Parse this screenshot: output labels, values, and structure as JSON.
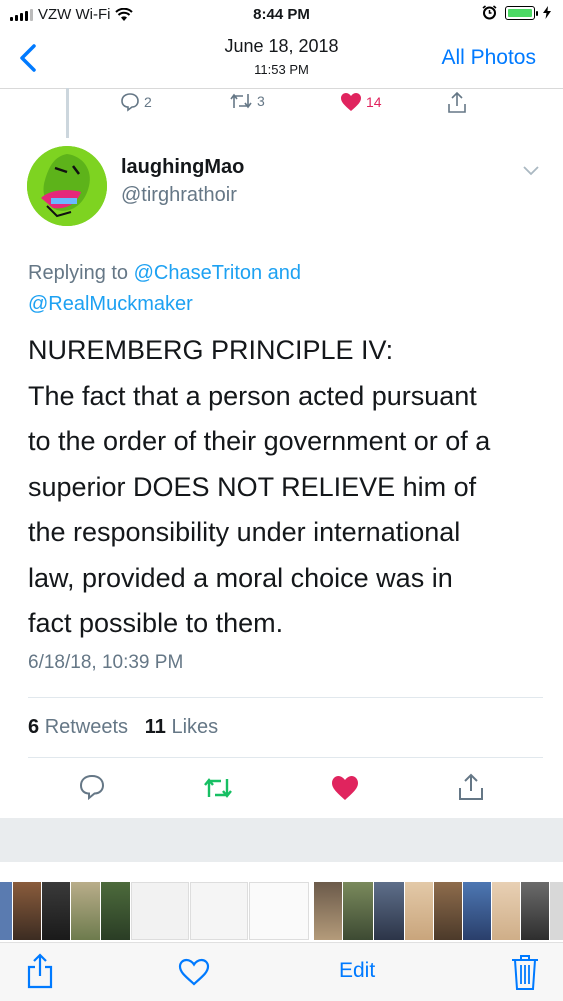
{
  "status_bar": {
    "carrier": "VZW Wi-Fi",
    "time": "8:44 PM",
    "icons": [
      "signal-bars-icon",
      "wifi-icon",
      "alarm-icon",
      "battery-icon",
      "charging-bolt-icon"
    ]
  },
  "nav": {
    "title": "June 18, 2018",
    "subtitle": "11:53 PM",
    "back_icon": "chevron-left-icon",
    "right_label": "All Photos"
  },
  "prev_tweet_actions": {
    "replies": "2",
    "retweets": "3",
    "likes": "14"
  },
  "tweet": {
    "user_name": "laughingMao",
    "user_handle": "@tirghrathoir",
    "replying_prefix": "Replying to ",
    "replying_mention_1": "@ChaseTriton",
    "replying_and": " and",
    "replying_mention_2": "@RealMuckmaker",
    "body_lines": [
      "NUREMBERG PRINCIPLE IV:",
      "The fact that a person acted pursuant",
      "to the order of their government or of a",
      "superior DOES NOT RELIEVE him of",
      "the responsibility under international",
      "law, provided a moral choice was in",
      "fact possible to them."
    ],
    "timestamp": "6/18/18, 10:39 PM",
    "retweets_count": "6",
    "retweets_label": "Retweets",
    "likes_count": "11",
    "likes_label": "Likes"
  },
  "colors": {
    "ios_blue": "#007aff",
    "twitter_blue": "#1da1f2",
    "retweet_green": "#17bf63",
    "like_red": "#e0245e",
    "gray_text": "#657786"
  },
  "toolbar": {
    "share_icon": "share-icon",
    "favorite_icon": "heart-icon",
    "edit_label": "Edit",
    "delete_icon": "trash-icon"
  }
}
